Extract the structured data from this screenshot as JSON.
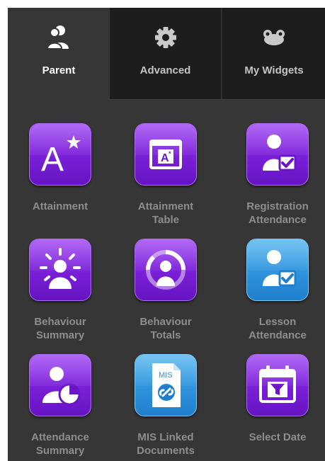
{
  "tabs": [
    {
      "label": "Parent",
      "icon": "parent-icon",
      "active": true
    },
    {
      "label": "Advanced",
      "icon": "gear-icon",
      "active": false
    },
    {
      "label": "My Widgets",
      "icon": "frog-icon",
      "active": false
    }
  ],
  "widgets": [
    {
      "label": "Attainment",
      "icon": "attainment-star-icon",
      "color": "#7a1fd8"
    },
    {
      "label": "Attainment\nTable",
      "icon": "attainment-table-icon",
      "color": "#7a1fd8"
    },
    {
      "label": "Registration\nAttendance",
      "icon": "registration-checkmark-icon",
      "color": "#7a1fd8"
    },
    {
      "label": "Behaviour\nSummary",
      "icon": "behaviour-sun-icon",
      "color": "#7a1fd8"
    },
    {
      "label": "Behaviour\nTotals",
      "icon": "behaviour-person-ring-icon",
      "color": "#7a1fd8"
    },
    {
      "label": "Lesson\nAttendance",
      "icon": "lesson-checkmark-icon",
      "color": "#2f93dd"
    },
    {
      "label": "Attendance\nSummary",
      "icon": "attendance-pie-icon",
      "color": "#7a1fd8"
    },
    {
      "label": "MIS Linked\nDocuments",
      "icon": "mis-document-icon",
      "color": "#2f93dd",
      "doc_badge": "MIS"
    },
    {
      "label": "Select Date",
      "icon": "calendar-filter-icon",
      "color": "#7a1fd8"
    }
  ],
  "colors": {
    "panel_bg": "#363636",
    "inactive_tab_bg": "#1d1d1d",
    "label_color": "#8d8d8d",
    "purple": "#7a1fd8",
    "blue": "#2f93dd"
  }
}
